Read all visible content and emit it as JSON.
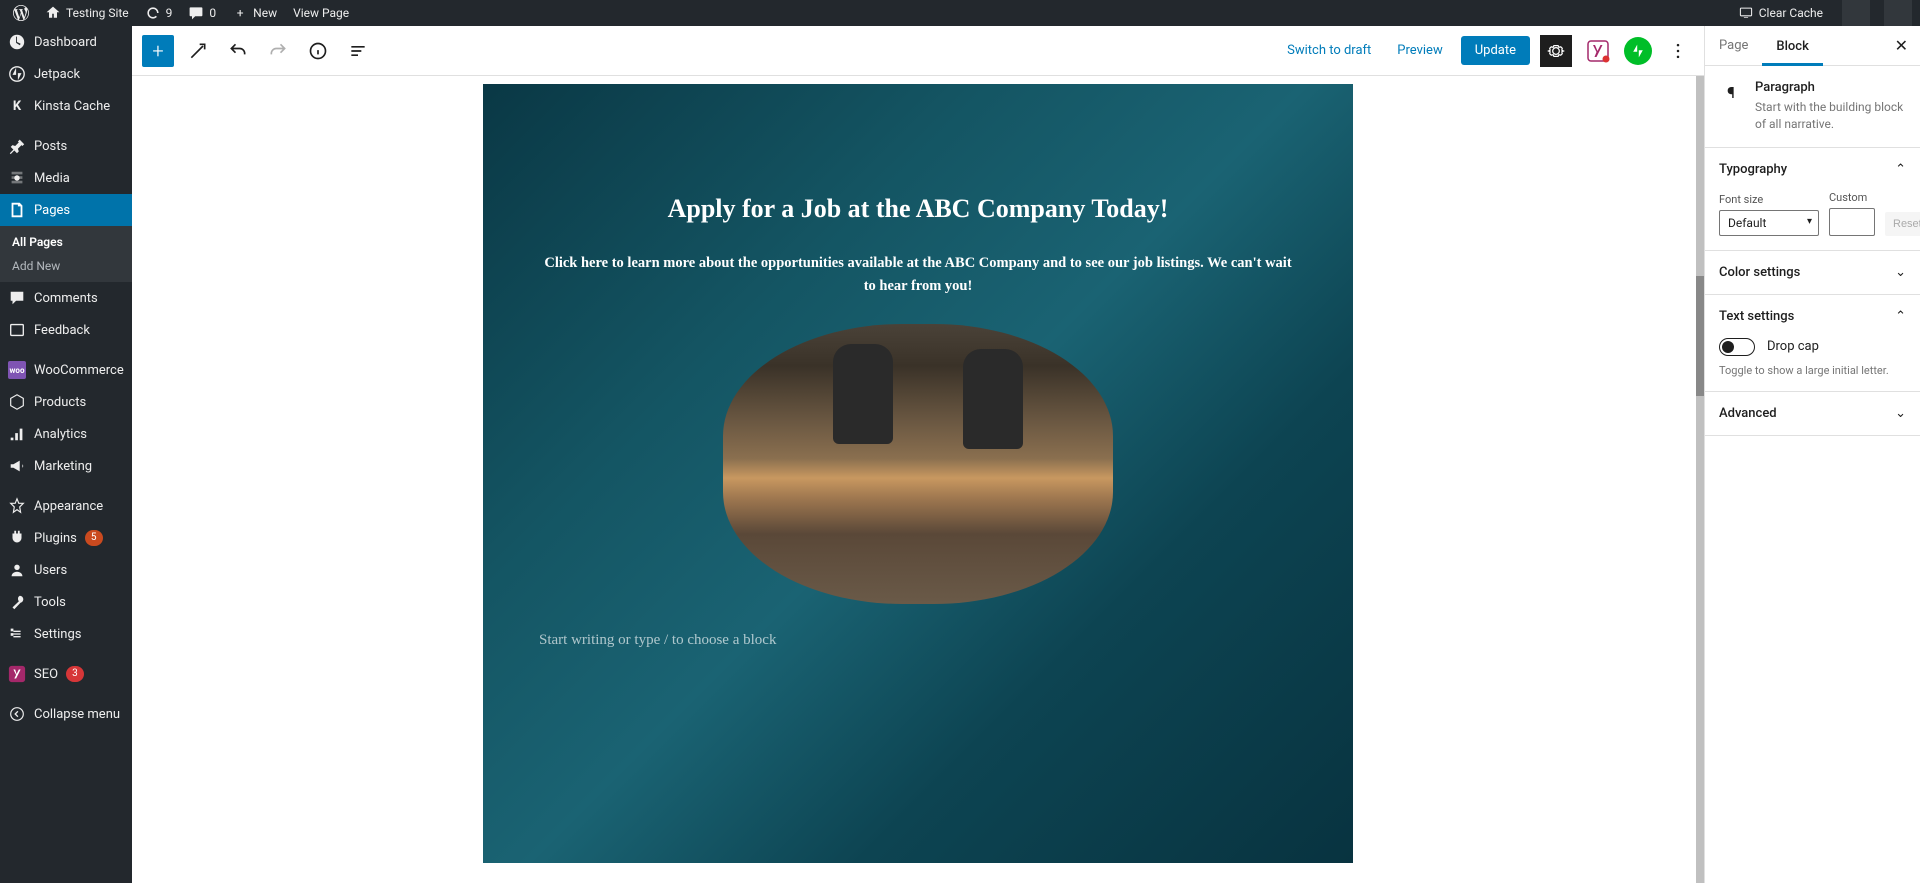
{
  "adminBar": {
    "siteName": "Testing Site",
    "updateCount": "9",
    "commentCount": "0",
    "newLabel": "New",
    "viewPage": "View Page",
    "clearCache": "Clear Cache"
  },
  "sidebar": {
    "items": [
      {
        "label": "Dashboard"
      },
      {
        "label": "Jetpack"
      },
      {
        "label": "Kinsta Cache"
      },
      {
        "label": "Posts"
      },
      {
        "label": "Media"
      },
      {
        "label": "Pages",
        "active": true,
        "submenu": [
          "All Pages",
          "Add New"
        ]
      },
      {
        "label": "Comments"
      },
      {
        "label": "Feedback"
      },
      {
        "label": "WooCommerce"
      },
      {
        "label": "Products"
      },
      {
        "label": "Analytics"
      },
      {
        "label": "Marketing"
      },
      {
        "label": "Appearance"
      },
      {
        "label": "Plugins",
        "badge": "5"
      },
      {
        "label": "Users"
      },
      {
        "label": "Tools"
      },
      {
        "label": "Settings"
      },
      {
        "label": "SEO",
        "badge": "3"
      },
      {
        "label": "Collapse menu"
      }
    ]
  },
  "editorHeader": {
    "switchDraft": "Switch to draft",
    "preview": "Preview",
    "update": "Update"
  },
  "content": {
    "heading": "Apply for a Job at the ABC Company Today!",
    "paragraph": "Click here to learn more about the opportunities available at the ABC Company and to see our job listings. We can't wait to hear from you!",
    "placeholder": "Start writing or type / to choose a block"
  },
  "inspector": {
    "tabs": {
      "page": "Page",
      "block": "Block"
    },
    "blockCard": {
      "title": "Paragraph",
      "desc": "Start with the building block of all narrative."
    },
    "panels": {
      "typography": "Typography",
      "color": "Color settings",
      "text": "Text settings",
      "advanced": "Advanced"
    },
    "fontSizeLabel": "Font size",
    "fontSizeValue": "Default",
    "customLabel": "Custom",
    "resetLabel": "Reset",
    "dropCapLabel": "Drop cap",
    "dropCapHelp": "Toggle to show a large initial letter."
  }
}
